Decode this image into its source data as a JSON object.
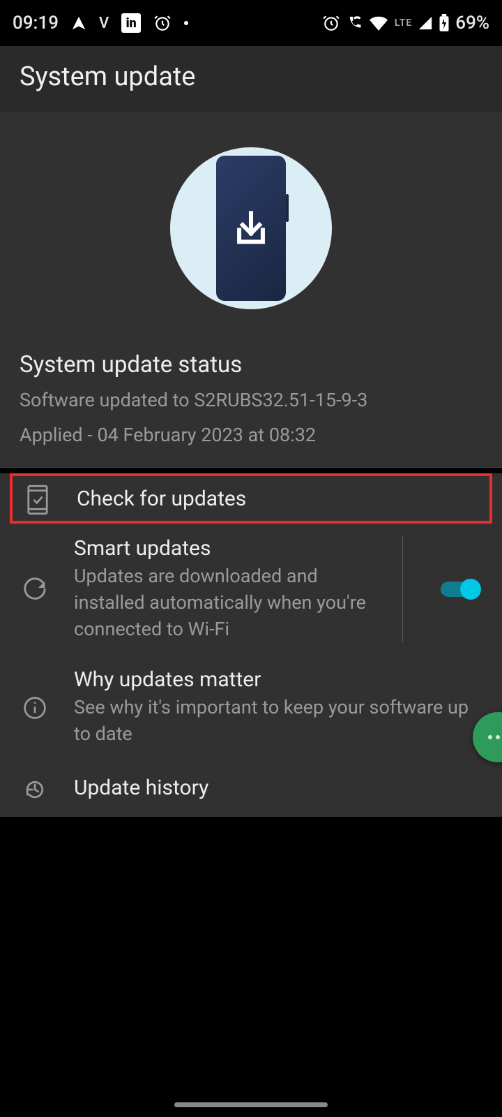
{
  "status_bar": {
    "time": "09:19",
    "lte": "LTE",
    "battery": "69%"
  },
  "header": {
    "title": "System update"
  },
  "status_section": {
    "heading": "System update status",
    "version": "Software updated to S2RUBS32.51-15-9-3",
    "applied": "Applied - 04 February 2023 at 08:32"
  },
  "items": {
    "check": {
      "label": "Check for updates"
    },
    "smart": {
      "title": "Smart updates",
      "desc": "Updates are downloaded and installed automatically when you're connected to Wi-Fi",
      "enabled": true
    },
    "why": {
      "title": "Why updates matter",
      "desc": "See why it's important to keep your software up to date"
    },
    "history": {
      "title": "Update history"
    }
  }
}
